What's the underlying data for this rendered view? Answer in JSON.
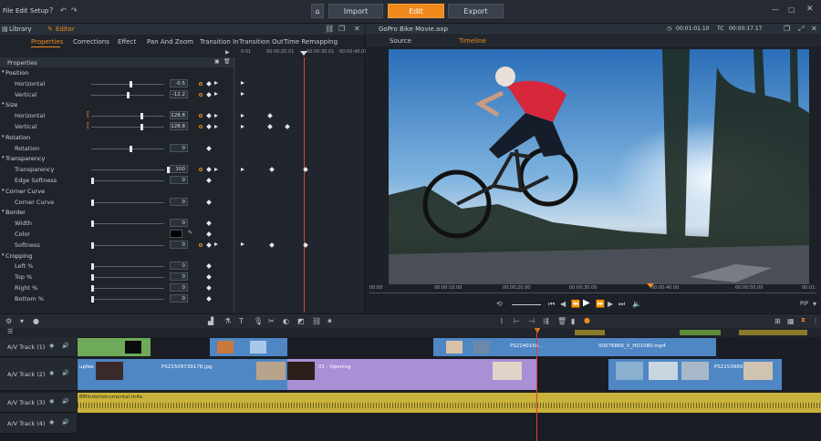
{
  "menu": {
    "file": "File",
    "edit": "Edit",
    "setup": "Setup"
  },
  "top_tabs": {
    "import": "Import",
    "edit": "Edit",
    "export": "Export"
  },
  "left_panel": {
    "library": "Library",
    "editor": "Editor",
    "tabs": [
      "Properties",
      "Corrections",
      "Effect",
      "Pan And Zoom",
      "Transition In",
      "Transition Out",
      "Time Remapping"
    ],
    "timecodes": [
      "0:01",
      "00:00:20.01",
      "00:00:30.01",
      "00:00:40.01"
    ],
    "properties_header": "Properties",
    "rows": [
      {
        "cat": "Position"
      },
      {
        "label": "Horizontal",
        "value": "-0.5"
      },
      {
        "label": "Vertical",
        "value": "-12.2"
      },
      {
        "cat": "Size"
      },
      {
        "label": "Horizontal",
        "value": "128.8"
      },
      {
        "label": "Vertical",
        "value": "128.8"
      },
      {
        "cat": "Rotation"
      },
      {
        "label": "Rotation",
        "value": "0"
      },
      {
        "cat": "Transparency"
      },
      {
        "label": "Transparency",
        "value": "100"
      },
      {
        "label": "Edge Softness",
        "value": "0"
      },
      {
        "cat": "Corner Curve"
      },
      {
        "label": "Corner Curve",
        "value": "0"
      },
      {
        "cat": "Border"
      },
      {
        "label": "Width",
        "value": "0"
      },
      {
        "label": "Color",
        "value": ""
      },
      {
        "label": "Softness",
        "value": "0"
      },
      {
        "cat": "Cropping"
      },
      {
        "label": "Left %",
        "value": "0"
      },
      {
        "label": "Top %",
        "value": "0"
      },
      {
        "label": "Right %",
        "value": "0"
      },
      {
        "label": "Bottom %",
        "value": "0"
      }
    ]
  },
  "right_panel": {
    "project": "GoPro Bike Movie.axp",
    "tc1": "00:01:01.10",
    "tc_label": "TC",
    "tc2": "00:00:17.17",
    "tabs": [
      "Source",
      "Timeline"
    ],
    "ruler": [
      "00:00",
      "00:00:10.00",
      "00:00:20.00",
      "00:00:30.00",
      "00:00:40.00",
      "00:00:50.00",
      "00:01:"
    ],
    "pip": "PIP"
  },
  "tracks": [
    {
      "name": "A/V Track (1)"
    },
    {
      "name": "A/V Track (2)"
    },
    {
      "name": "A/V Track (3)"
    },
    {
      "name": "A/V Track (4)"
    }
  ],
  "clips": {
    "t1a": "PS2140156...",
    "t1b": "00076866_V_HD1080.mp4",
    "t2a": "upfee",
    "t2b": "PS21509739178.jpg",
    "t2c": "01 - Opening",
    "t2d": "PS2153989...",
    "t3a": "BMindsInstrumental.m4a"
  },
  "colors": {
    "accent": "#f08a1c",
    "clip_blue": "#4f86c4",
    "clip_purple": "#a98fd6",
    "clip_audio": "#c9b23c",
    "clip_green": "#6faa5a"
  }
}
